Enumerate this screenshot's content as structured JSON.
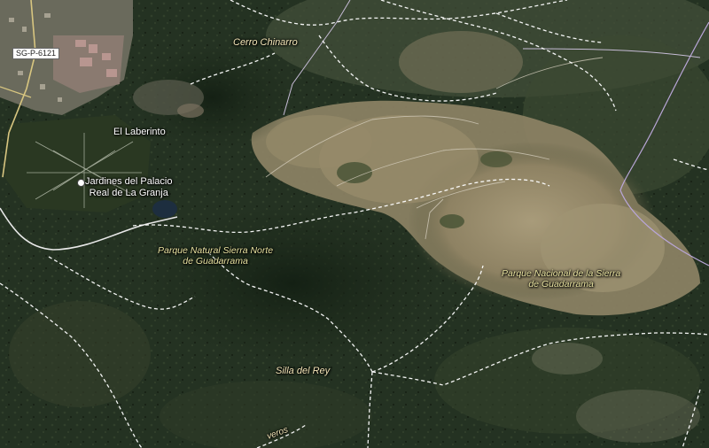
{
  "map": {
    "type": "satellite",
    "road_shield": "SG-P-6121",
    "labels": {
      "cerro": "Cerro Chinarro",
      "laberinto": "El Laberinto",
      "jardines_line1": "Jardines del Palacio",
      "jardines_line2": "Real de La Granja",
      "parque_natural_line1": "Parque Natural Sierra Norte",
      "parque_natural_line2": "de Guadarrama",
      "parque_nacional_line1": "Parque Nacional de la Sierra",
      "parque_nacional_line2": "de Guadarrama",
      "silla": "Silla del Rey",
      "partial_road": "veros"
    },
    "colors": {
      "forest": "#243222",
      "bare_terrain": "#9c8f6f",
      "trail": "#ffffff",
      "boundary": "#b9a6d8"
    }
  }
}
